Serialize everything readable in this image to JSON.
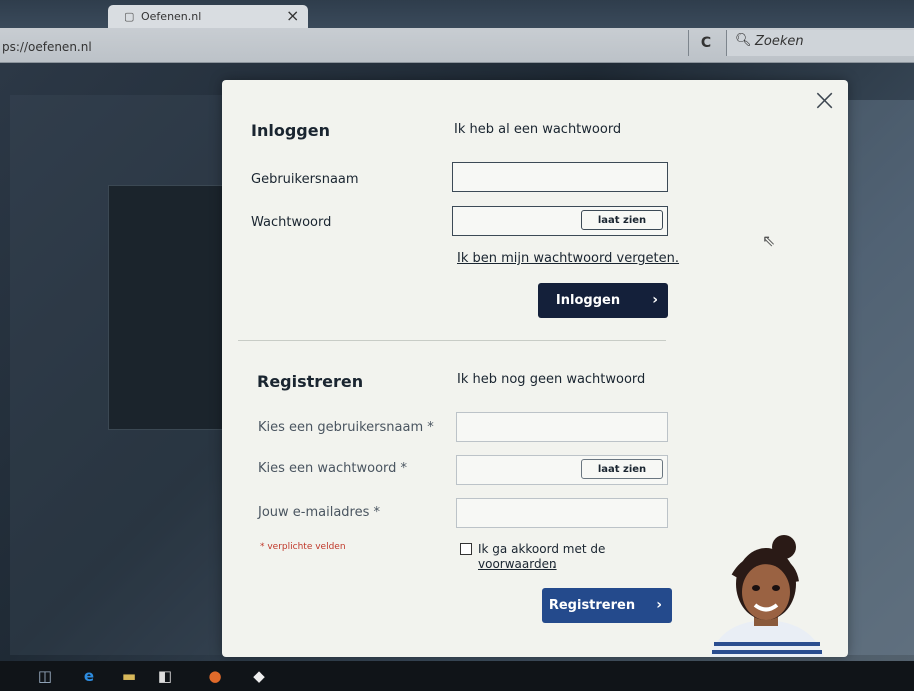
{
  "browser": {
    "tab_title": "Oefenen.nl",
    "tab_icon": "page-icon",
    "tab_close": "×",
    "url": "ps://oefenen.nl",
    "reload_icon": "C",
    "search_placeholder": "Zoeken"
  },
  "modal": {
    "close_symbol": "×",
    "login": {
      "heading": "Inloggen",
      "subheading": "Ik heb al een wachtwoord",
      "username_label": "Gebruikersnaam",
      "password_label": "Wachtwoord",
      "show_label": "laat zien",
      "forgot_link": "Ik ben mijn wachtwoord vergeten.",
      "submit_label": "Inloggen",
      "submit_chevron": "›"
    },
    "register": {
      "heading": "Registreren",
      "subheading": "Ik heb nog geen wachtwoord",
      "username_label": "Kies een gebruikersnaam *",
      "password_label": "Kies een wachtwoord *",
      "email_label": "Jouw e-mailadres *",
      "show_label": "laat zien",
      "required_note": "* verplichte velden",
      "agree_text": "Ik ga akkoord met de",
      "agree_link": "voorwaarden",
      "agree_end": ".",
      "submit_label": "Registreren",
      "submit_chevron": "›"
    }
  },
  "colors": {
    "login_button": "#14203a",
    "register_button": "#244a8c",
    "required_text": "#c0392b"
  }
}
